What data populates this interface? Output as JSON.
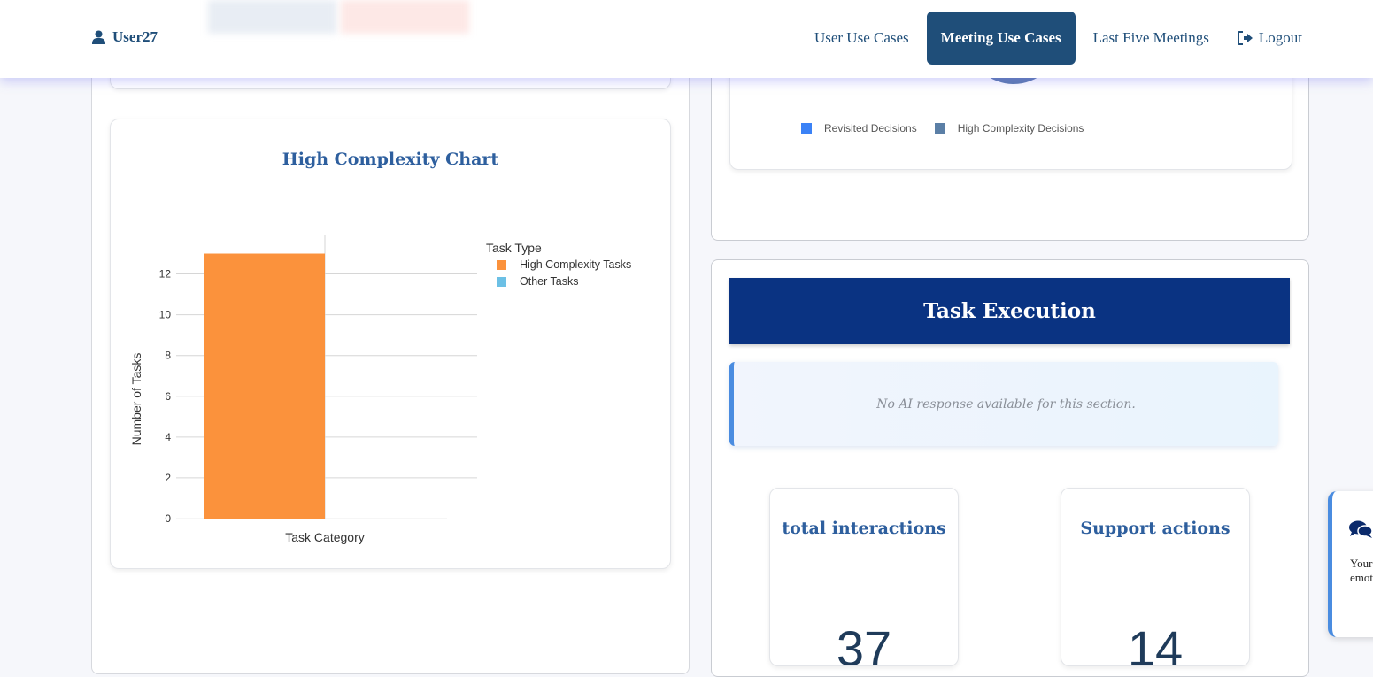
{
  "nav": {
    "user": "User27",
    "links": [
      "User Use Cases",
      "Meeting Use Cases",
      "Last Five Meetings"
    ],
    "active_link": "Meeting Use Cases",
    "logout": "Logout"
  },
  "decisions_legend": {
    "items": [
      {
        "label": "Revisited Decisions",
        "color": "#3b82f6"
      },
      {
        "label": "High Complexity Decisions",
        "color": "#5b7fa6"
      }
    ]
  },
  "chart_card": {
    "title": "High Complexity Chart"
  },
  "chart_data": {
    "type": "bar",
    "xlabel": "Task Category",
    "ylabel": "Number of Tasks",
    "legend_title": "Task Type",
    "series": [
      {
        "name": "High Complexity Tasks",
        "color": "#fb923c",
        "values": [
          13
        ]
      },
      {
        "name": "Other Tasks",
        "color": "#6cc0e5",
        "values": [
          0
        ]
      }
    ],
    "yticks": [
      0,
      2,
      4,
      6,
      8,
      10,
      12
    ],
    "ylim": [
      0,
      13.5
    ],
    "legend_position": "top-right"
  },
  "task_execution": {
    "title": "Task Execution",
    "ai_response": "No AI response available for this section.",
    "stats": [
      {
        "label": "total interactions",
        "value": "37"
      },
      {
        "label": "Support actions",
        "value": "14"
      }
    ]
  },
  "chat": {
    "text": "Your overa intera emoti"
  }
}
